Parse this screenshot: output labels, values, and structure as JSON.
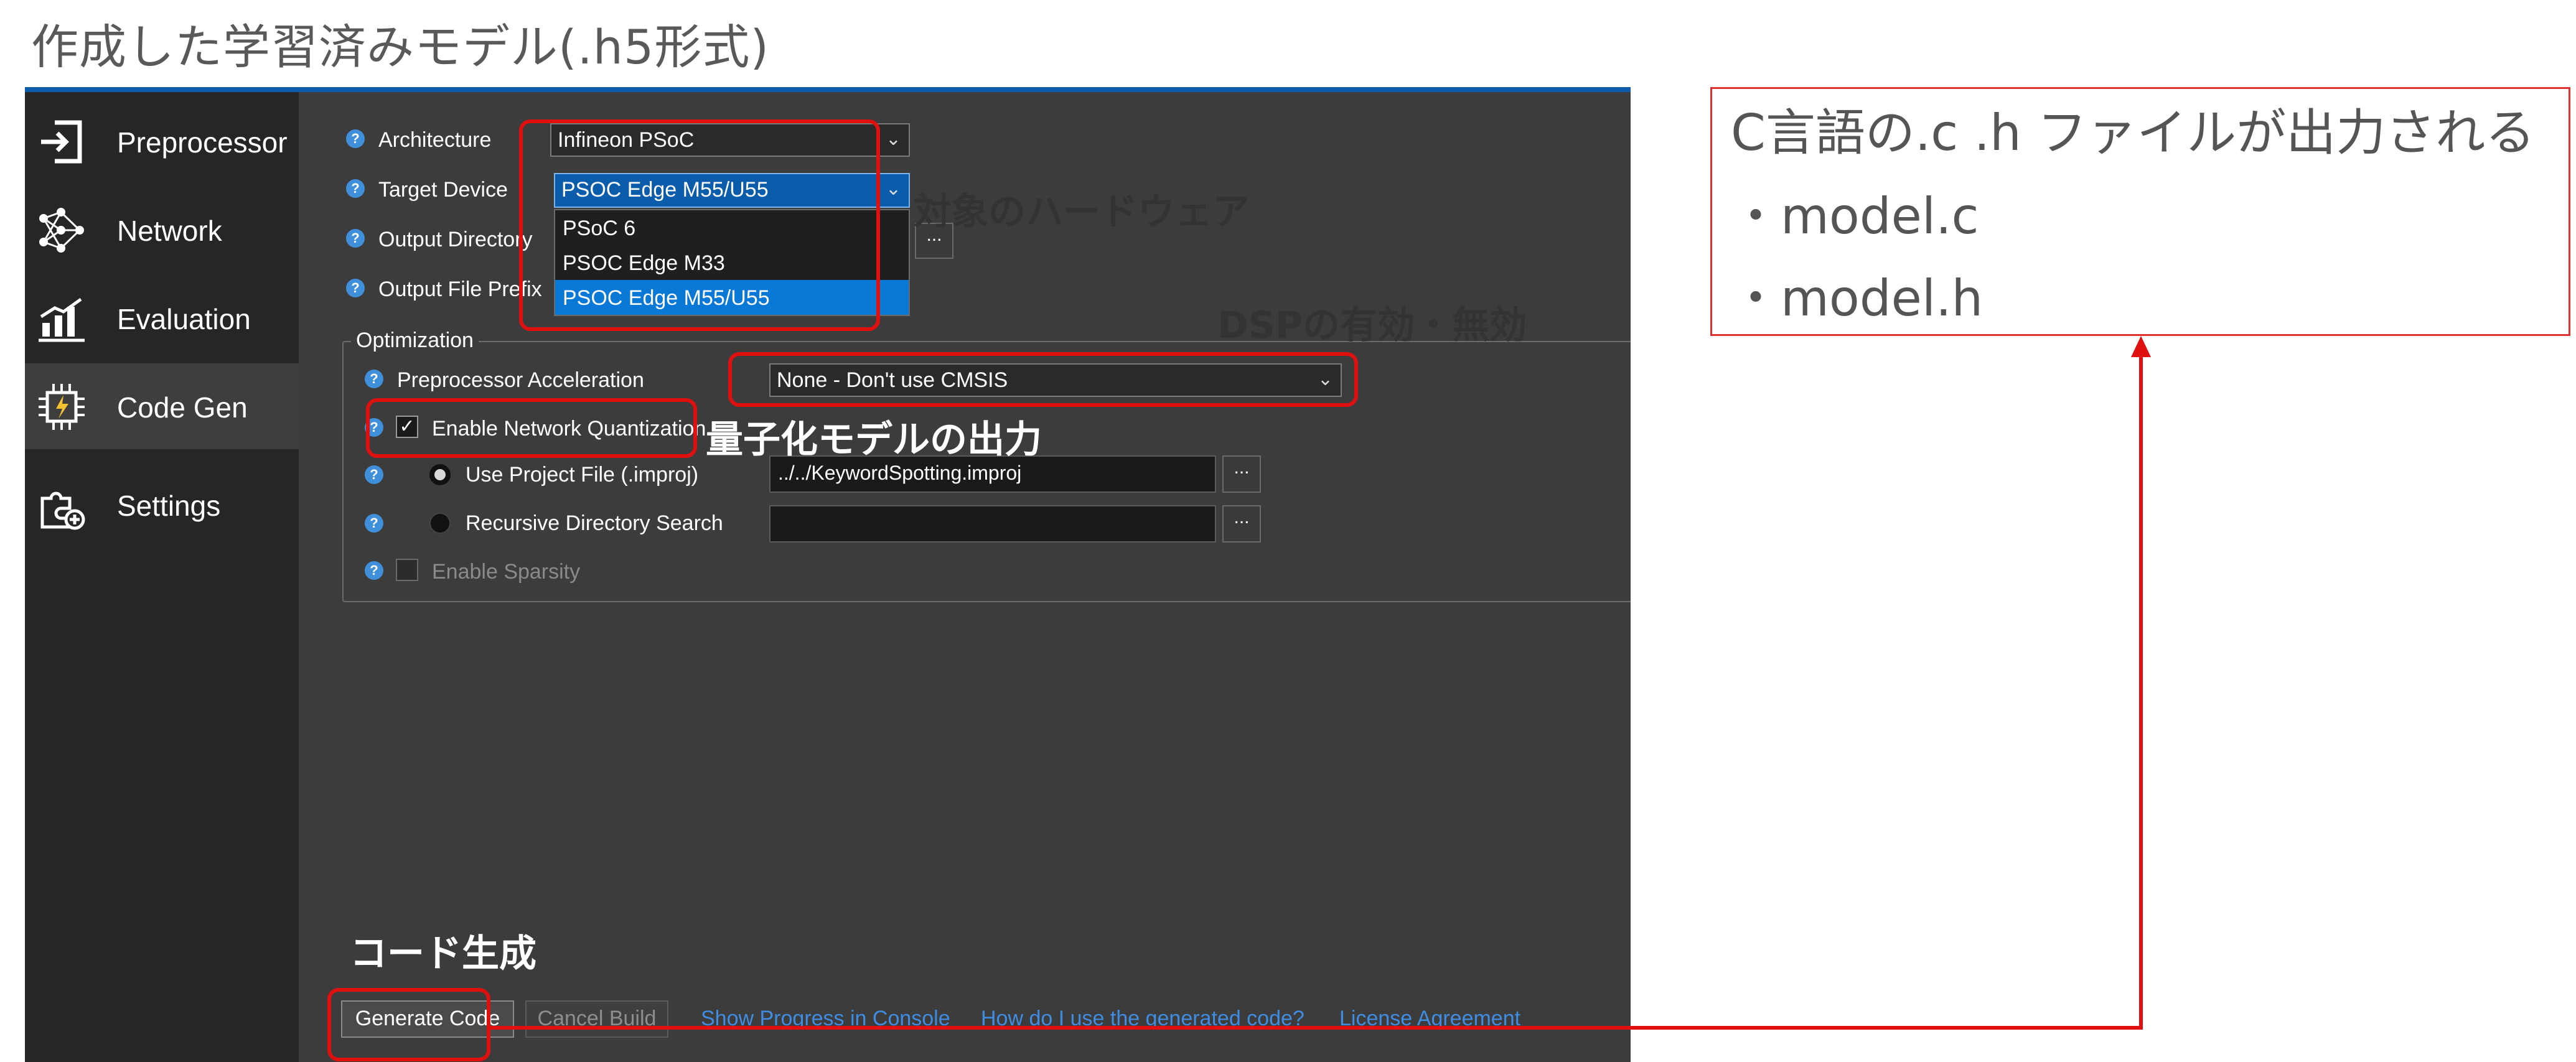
{
  "page_title": "作成した学習済みモデル(.h5形式)",
  "sidebar": {
    "items": [
      {
        "label": "Preprocessor",
        "icon": "sign-in-icon",
        "active": false
      },
      {
        "label": "Network",
        "icon": "network-icon",
        "active": false
      },
      {
        "label": "Evaluation",
        "icon": "bar-chart-icon",
        "active": false
      },
      {
        "label": "Code Gen",
        "icon": "chip-icon",
        "active": true
      },
      {
        "label": "Settings",
        "icon": "settings-puzzle-icon",
        "active": false
      }
    ]
  },
  "form": {
    "architecture_label": "Architecture",
    "architecture_value": "Infineon PSoC",
    "target_device_label": "Target Device",
    "target_device_value": "PSOC Edge M55/U55",
    "target_device_options": [
      "PSoC 6",
      "PSOC Edge M33",
      "PSOC Edge M55/U55"
    ],
    "output_directory_label": "Output Directory",
    "output_file_prefix_label": "Output File Prefix",
    "browse_label": "...",
    "optimization_label": "Optimization",
    "preprocessor_acceleration_label": "Preprocessor Acceleration",
    "preprocessor_acceleration_value": "None - Don't use CMSIS",
    "enable_quantization_label": "Enable Network Quantization",
    "enable_quantization_checked": true,
    "use_project_file_label": "Use Project File (.improj)",
    "project_file_value": "../../KeywordSpotting.improj",
    "recursive_search_label": "Recursive Directory Search",
    "enable_sparsity_label": "Enable Sparsity",
    "enable_sparsity_checked": false
  },
  "buttons": {
    "generate": "Generate Code",
    "cancel": "Cancel Build"
  },
  "links": {
    "show_progress": "Show Progress in Console",
    "how_to_use": "How do I use the generated code?",
    "license": "License Agreement"
  },
  "annotations": {
    "target_hw": "対象のハードウェア",
    "dsp": "DSPの有効・無効",
    "quantized": "量子化モデルの出力",
    "codegen": "コード生成",
    "output_title": "C言語の.c .h ファイルが出力される",
    "output_files": [
      "・model.c",
      "・model.h"
    ]
  },
  "colors": {
    "annotation_red": "#e01010",
    "accent_blue": "#0b5cab",
    "link_blue": "#3f8de3"
  }
}
